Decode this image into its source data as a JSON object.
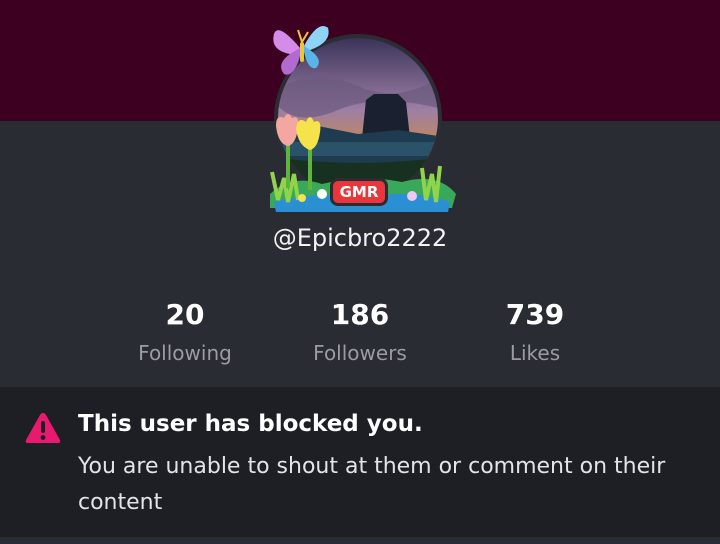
{
  "profile": {
    "username": "@Epicbro2222",
    "badge": "GMR"
  },
  "stats": [
    {
      "value": "20",
      "label": "Following"
    },
    {
      "value": "186",
      "label": "Followers"
    },
    {
      "value": "739",
      "label": "Likes"
    }
  ],
  "notice": {
    "title": "This user has blocked you.",
    "body": "You are unable to shout at them or comment on their content"
  },
  "icons": {
    "avatar_decoration": "butterfly-icon",
    "avatar_frame": "tulip-flowers-frame",
    "warning": "warning-triangle-icon"
  },
  "colors": {
    "banner": "#3d0020",
    "badge": "#e8363b",
    "warning": "#e8196e"
  }
}
